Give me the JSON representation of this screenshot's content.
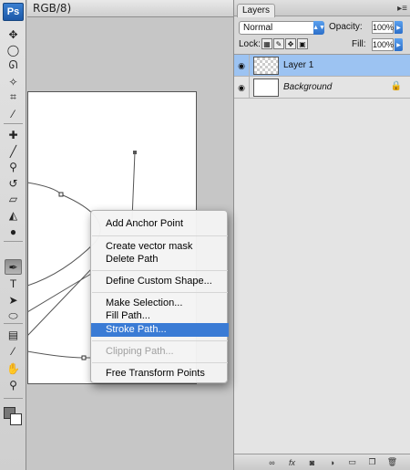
{
  "app": {
    "logo": "Ps"
  },
  "document": {
    "title": "RGB/8)"
  },
  "toolbar": {
    "tools": [
      {
        "name": "move-tool-icon",
        "glyph": "✥"
      },
      {
        "name": "marquee-tool-icon",
        "glyph": "◯"
      },
      {
        "name": "lasso-tool-icon",
        "glyph": "ᘏ"
      },
      {
        "name": "magic-wand-tool-icon",
        "glyph": "✧"
      },
      {
        "name": "crop-tool-icon",
        "glyph": "⌗"
      },
      {
        "name": "eyedropper-tool-icon",
        "glyph": "⁄"
      },
      {
        "name": "healing-brush-tool-icon",
        "glyph": "✚"
      },
      {
        "name": "brush-tool-icon",
        "glyph": "╱"
      },
      {
        "name": "clone-stamp-tool-icon",
        "glyph": "⚲"
      },
      {
        "name": "history-brush-tool-icon",
        "glyph": "↺"
      },
      {
        "name": "eraser-tool-icon",
        "glyph": "▱"
      },
      {
        "name": "paint-bucket-tool-icon",
        "glyph": "◭"
      },
      {
        "name": "blur-tool-icon",
        "glyph": "●"
      },
      {
        "name": "pen-tool-icon",
        "glyph": "✒"
      },
      {
        "name": "type-tool-icon",
        "glyph": "T"
      },
      {
        "name": "path-selection-tool-icon",
        "glyph": "➤"
      },
      {
        "name": "shape-tool-icon",
        "glyph": "⬭"
      },
      {
        "name": "notes-tool-icon",
        "glyph": "▤"
      },
      {
        "name": "eyedropper-2-tool-icon",
        "glyph": "⁄"
      },
      {
        "name": "hand-tool-icon",
        "glyph": "✋"
      },
      {
        "name": "zoom-tool-icon",
        "glyph": "⚲"
      }
    ],
    "active_tool": "pen-tool-icon",
    "foreground_color": "#777777",
    "background_color": "#ffffff"
  },
  "layers_panel": {
    "tab_label": "Layers",
    "menu_icon": "▸≡",
    "blend_mode": "Normal",
    "opacity_label": "Opacity:",
    "opacity_value": "100%",
    "lock_label": "Lock:",
    "fill_label": "Fill:",
    "fill_value": "100%",
    "layers": [
      {
        "name": "Layer 1",
        "selected": true,
        "thumb": "transparent",
        "locked": false
      },
      {
        "name": "Background",
        "selected": false,
        "thumb": "white",
        "locked": true
      }
    ],
    "bottom_buttons": [
      "link-layers-icon",
      "fx-icon",
      "layer-mask-icon",
      "adjustment-layer-icon",
      "new-group-icon",
      "new-layer-icon",
      "trash-icon"
    ]
  },
  "context_menu": {
    "items": [
      {
        "label": "Add Anchor Point",
        "state": "normal"
      },
      {
        "label": "Create vector mask",
        "state": "normal"
      },
      {
        "label": "Delete Path",
        "state": "normal"
      },
      {
        "label": "Define Custom Shape...",
        "state": "normal"
      },
      {
        "label": "Make Selection...",
        "state": "normal"
      },
      {
        "label": "Fill Path...",
        "state": "normal"
      },
      {
        "label": "Stroke Path...",
        "state": "selected"
      },
      {
        "label": "Clipping Path...",
        "state": "disabled"
      },
      {
        "label": "Free Transform Points",
        "state": "normal"
      }
    ]
  },
  "colors": {
    "accent": "#3a7bd5",
    "selected_layer": "#9cc3f2"
  }
}
